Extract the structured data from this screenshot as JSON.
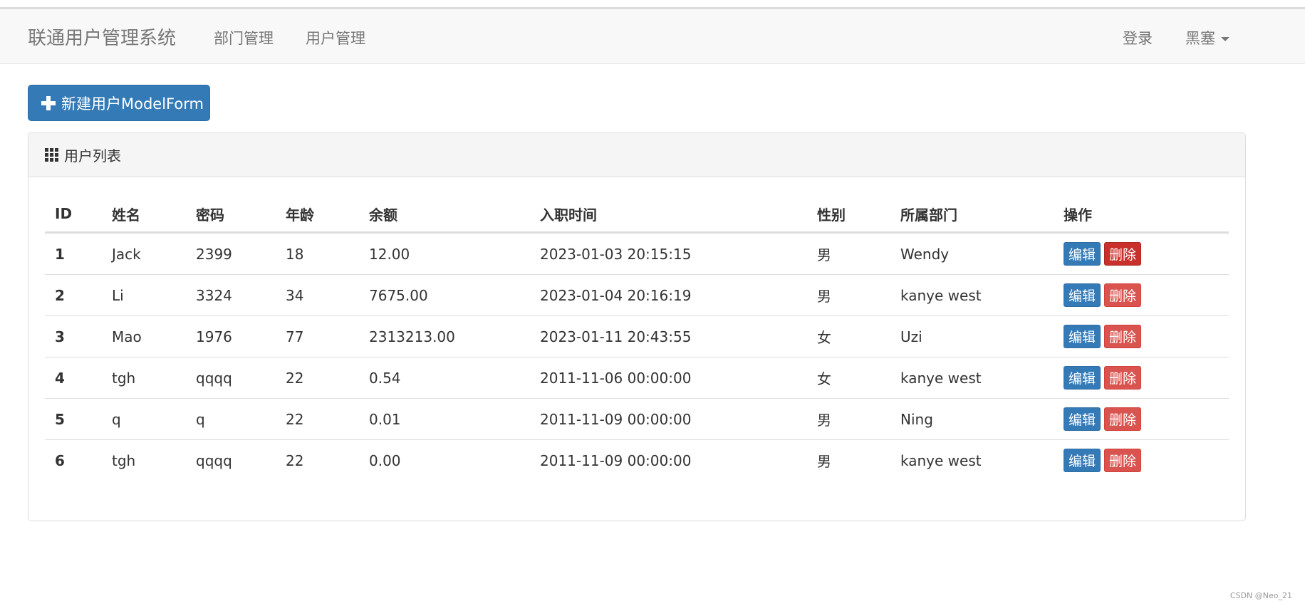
{
  "navbar": {
    "brand": "联通用户管理系统",
    "links": [
      "部门管理",
      "用户管理"
    ],
    "login": "登录",
    "user_menu": "黑塞"
  },
  "toolbar": {
    "add_label": "新建用户ModelForm",
    "add_icon": "plus-icon"
  },
  "panel": {
    "title": "用户列表",
    "title_icon": "grid-icon"
  },
  "table": {
    "headers": [
      "ID",
      "姓名",
      "密码",
      "年龄",
      "余额",
      "入职时间",
      "性别",
      "所属部门",
      "操作"
    ],
    "rows": [
      {
        "id": "1",
        "name": "Jack",
        "password": "2399",
        "age": "18",
        "account": "12.00",
        "create_time": "2023-01-03 20:15:15",
        "gender": "男",
        "depart": "Wendy"
      },
      {
        "id": "2",
        "name": "Li",
        "password": "3324",
        "age": "34",
        "account": "7675.00",
        "create_time": "2023-01-04 20:16:19",
        "gender": "男",
        "depart": "kanye west"
      },
      {
        "id": "3",
        "name": "Mao",
        "password": "1976",
        "age": "77",
        "account": "2313213.00",
        "create_time": "2023-01-11 20:43:55",
        "gender": "女",
        "depart": "Uzi"
      },
      {
        "id": "4",
        "name": "tgh",
        "password": "qqqq",
        "age": "22",
        "account": "0.54",
        "create_time": "2011-11-06 00:00:00",
        "gender": "女",
        "depart": "kanye west"
      },
      {
        "id": "5",
        "name": "q",
        "password": "q",
        "age": "22",
        "account": "0.01",
        "create_time": "2011-11-09 00:00:00",
        "gender": "男",
        "depart": "Ning"
      },
      {
        "id": "6",
        "name": "tgh",
        "password": "qqqq",
        "age": "22",
        "account": "0.00",
        "create_time": "2011-11-09 00:00:00",
        "gender": "男",
        "depart": "kanye west"
      }
    ],
    "edit_label": "编辑",
    "delete_label": "删除"
  },
  "colors": {
    "primary": "#337ab7",
    "danger": "#d9534f",
    "danger_active": "#c9302c",
    "navbar_bg": "#f8f8f8"
  },
  "watermark": "CSDN @Neo_21"
}
